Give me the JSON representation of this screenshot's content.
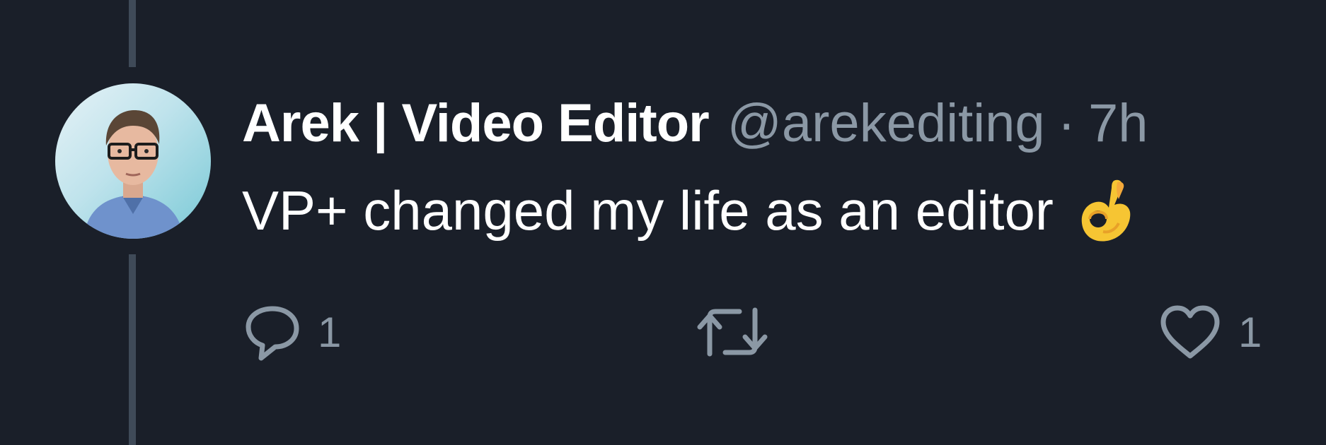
{
  "tweet": {
    "display_name": "Arek | Video Editor",
    "handle": "@arekediting",
    "separator": "·",
    "time": "7h",
    "text": "VP+ changed my life as an editor",
    "emoji": "ok-hand-emoji",
    "avatar": "user-avatar-photo"
  },
  "actions": {
    "reply": {
      "icon": "reply-icon",
      "count": "1"
    },
    "retweet": {
      "icon": "retweet-icon",
      "count": ""
    },
    "like": {
      "icon": "heart-icon",
      "count": "1"
    }
  },
  "colors": {
    "background": "#1a1f29",
    "text": "#ffffff",
    "muted": "#8b98a5",
    "thread_line": "#3f4a58"
  }
}
